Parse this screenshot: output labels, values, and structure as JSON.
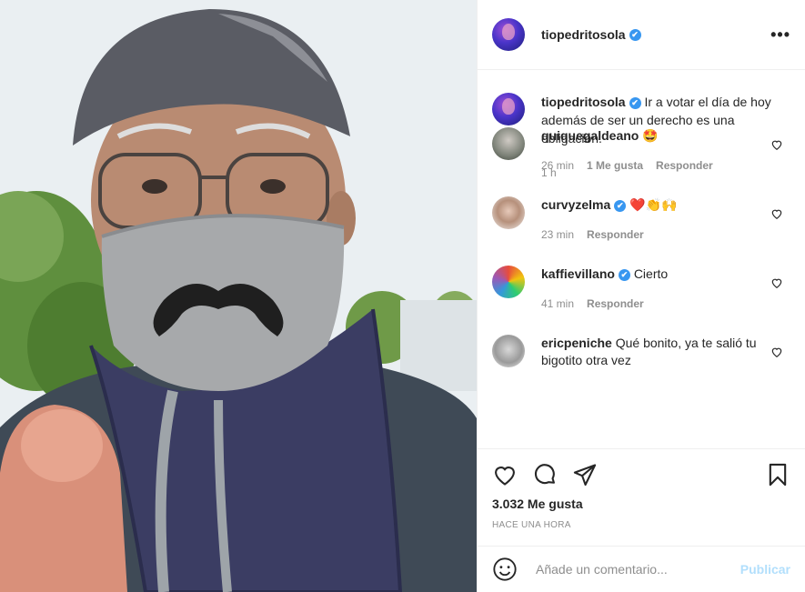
{
  "header": {
    "username": "tiopedritosola",
    "verified": "✔",
    "more": "•••"
  },
  "caption": {
    "username": "tiopedritosola",
    "verified": "✔",
    "text": "Ir a votar el día de hoy además de ser un derecho es una obligación.",
    "time": "1 h"
  },
  "comments": [
    {
      "username": "quiquegaldeano",
      "text": "🤩",
      "time": "26 min",
      "likes": "1 Me gusta",
      "reply": "Responder"
    },
    {
      "username": "curvyzelma",
      "verified": "✔",
      "text": "❤️👏🙌",
      "time": "23 min",
      "reply": "Responder"
    },
    {
      "username": "kaffievillano",
      "verified": "✔",
      "text": "Cierto",
      "time": "41 min",
      "reply": "Responder"
    },
    {
      "username": "ericpeniche",
      "text": "Qué bonito, ya te salió tu bigotito otra vez"
    }
  ],
  "likes": "3.032 Me gusta",
  "posted_ago": "HACE UNA HORA",
  "add_comment": {
    "placeholder": "Añade un comentario...",
    "publish": "Publicar"
  },
  "colors": {
    "verified": "#3897f0",
    "publish_disabled": "#b2dffc",
    "meta_gray": "#8e8e8e"
  },
  "icons": [
    "heart-icon",
    "comment-icon",
    "share-icon",
    "bookmark-icon",
    "more-icon",
    "emoji-icon"
  ]
}
